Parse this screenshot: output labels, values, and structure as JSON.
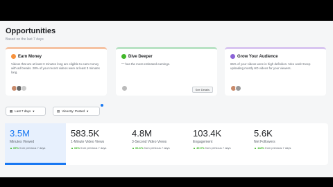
{
  "header": {
    "title": "Opportunities",
    "subtitle": "Based on the last 7 days"
  },
  "cards": [
    {
      "title": "Earn Money",
      "icon": "dollar-icon",
      "color": "#f7923e",
      "body": "Videos that are at least 3 minutes long are eligible to earn money with ad breaks. 28% of your recent videos were at least 3 minutes long."
    },
    {
      "title": "Dive Deeper",
      "icon": "chart-icon",
      "color": "#42b72a",
      "body": "\"                                    \" has the most estimated earnings.",
      "button": "See Details"
    },
    {
      "title": "Grow Your Audience",
      "icon": "people-icon",
      "color": "#8c64d8",
      "body": "65% of your videos were in high definition. Nice work! Keep uploading mostly HD videos for your viewers."
    }
  ],
  "filters": {
    "date": "Last 7 days",
    "view": "View By: Posted"
  },
  "metrics": [
    {
      "value": "3.5M",
      "label": "Minutes Viewed",
      "change": "▲ 69%",
      "suffix": " from previous 7 days"
    },
    {
      "value": "583.5K",
      "label": "1-Minute Video Views",
      "change": "▲ 64%",
      "suffix": " from previous 7 days"
    },
    {
      "value": "4.8M",
      "label": "3-Second Video Views",
      "change": "▲ 66.6%",
      "suffix": " from previous 7 days"
    },
    {
      "value": "103.4K",
      "label": "Engagement",
      "change": "▲ 49.9%",
      "suffix": " from previous 7 days"
    },
    {
      "value": "5.6K",
      "label": "Net Followers",
      "change": "▲ 118%",
      "suffix": " from previous 7 days"
    }
  ]
}
